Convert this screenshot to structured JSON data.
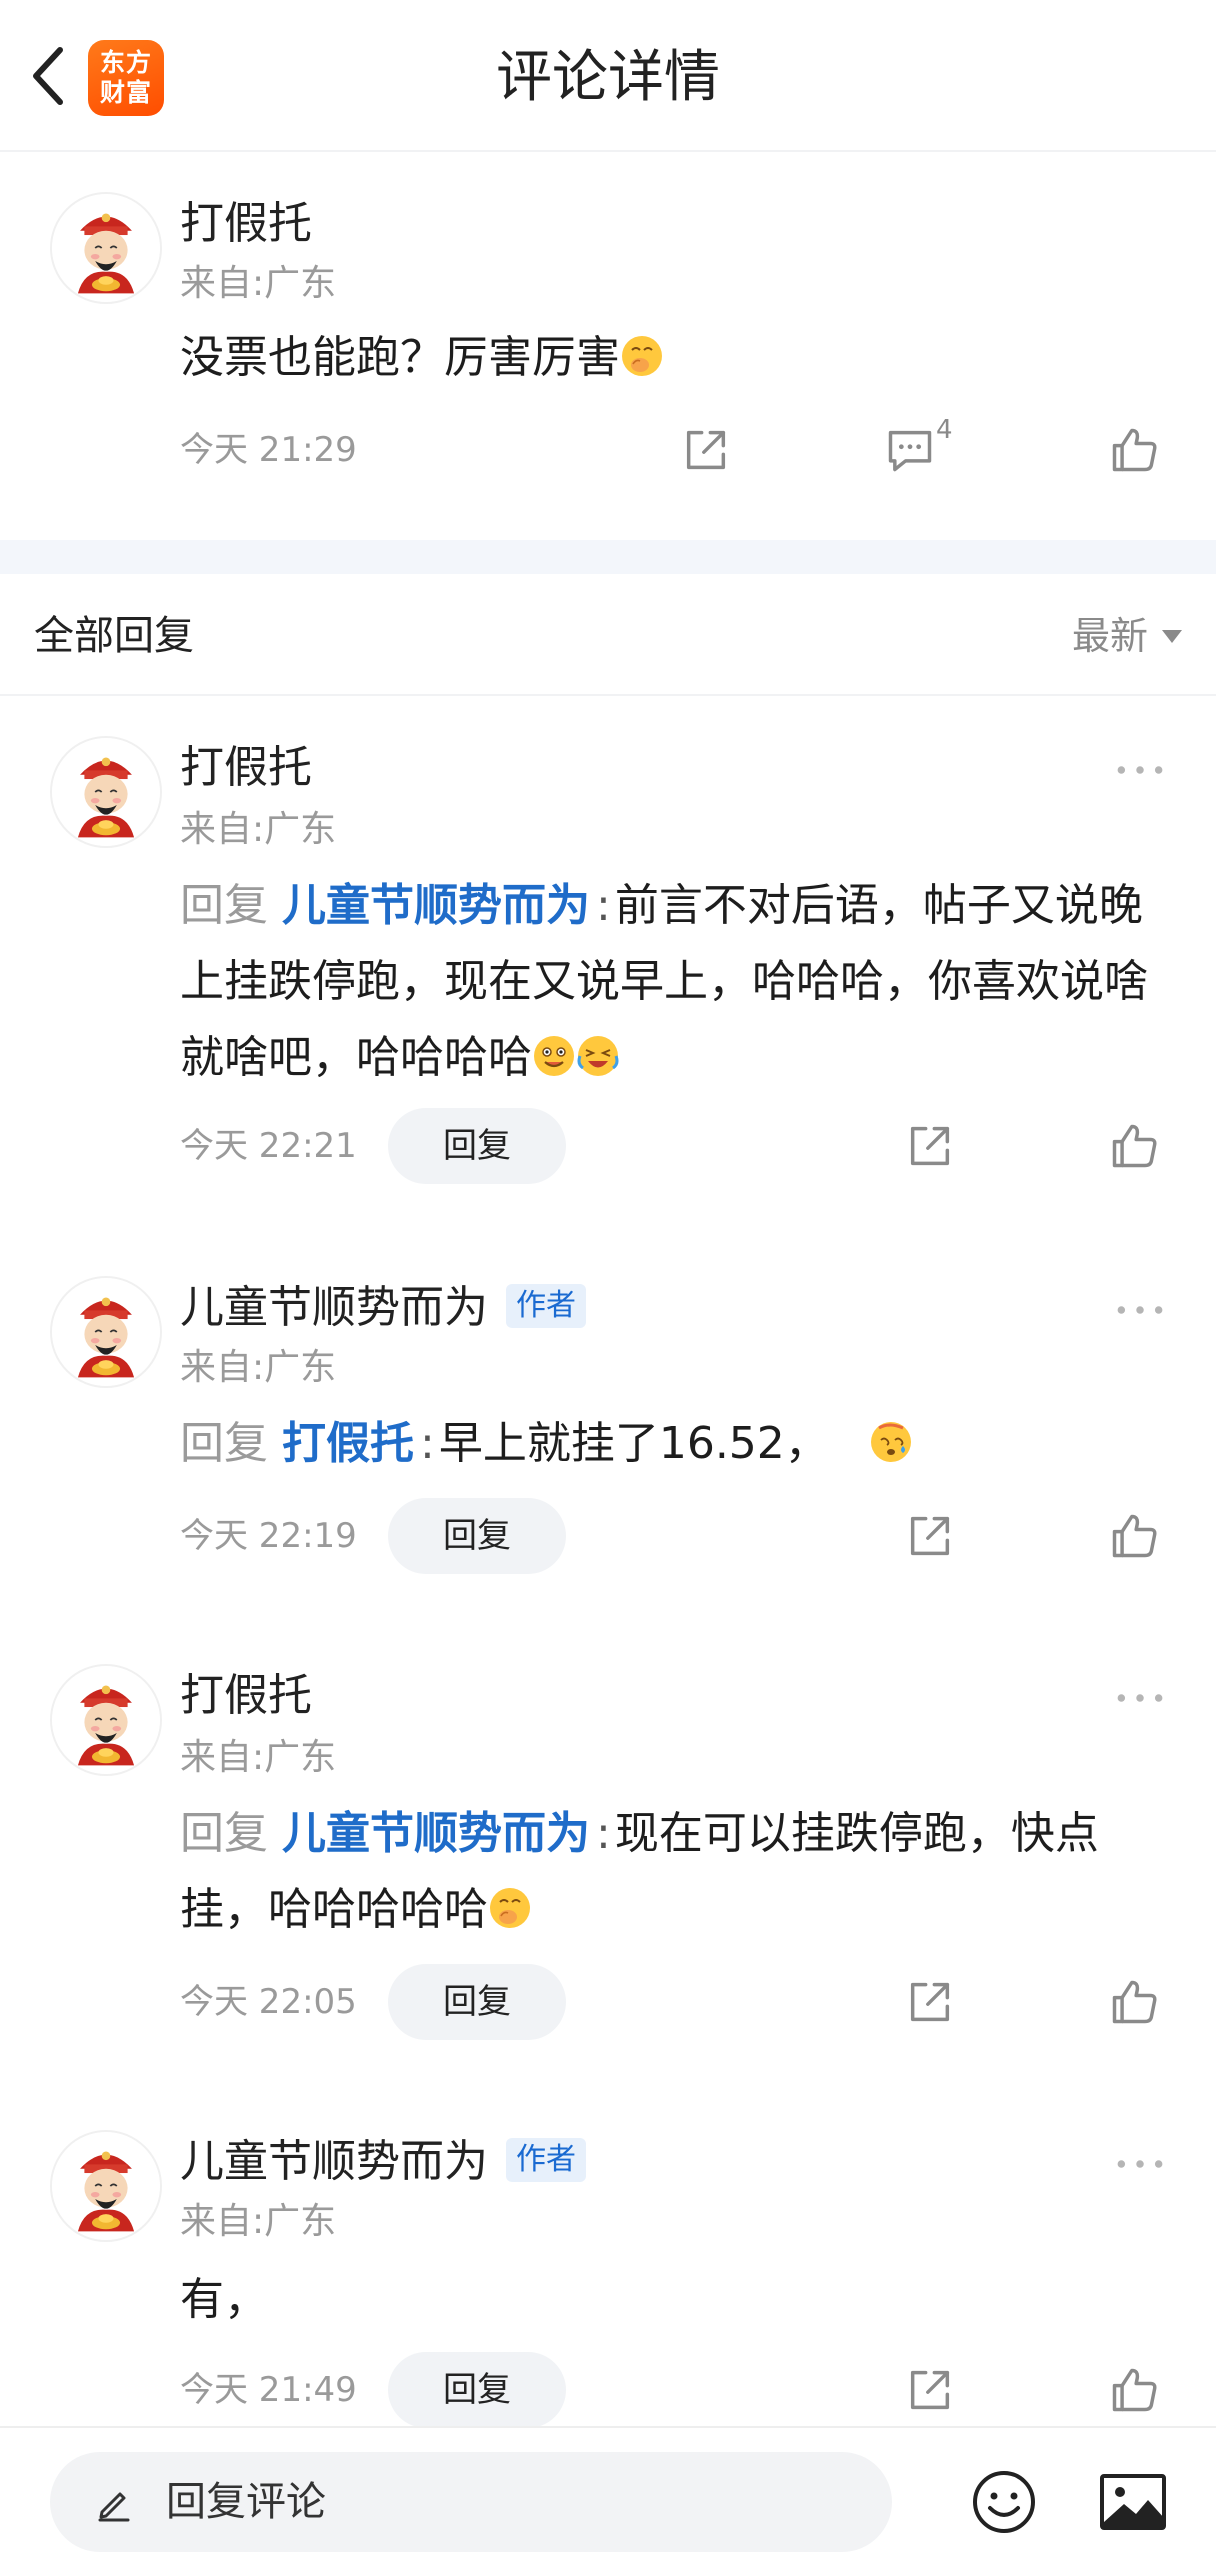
{
  "header": {
    "title": "评论详情",
    "logo_line1": "东方",
    "logo_line2": "财富"
  },
  "main_comment": {
    "username": "打假托",
    "location": "来自:广东",
    "text": "没票也能跑？厉害厉害",
    "time": "今天 21:29",
    "reply_count": "4"
  },
  "replies_section": {
    "title": "全部回复",
    "sort_label": "最新"
  },
  "replies": [
    {
      "username": "打假托",
      "is_author": false,
      "location": "来自:广东",
      "reply_prefix": "回复",
      "reply_to": "儿童节顺势而为",
      "colon": ":",
      "text": "前言不对后语，帖子又说晚上挂跌停跑，现在又说早上，哈哈哈，你喜欢说啥就啥吧，哈哈哈哈",
      "time": "今天 22:21",
      "reply_label": "回复"
    },
    {
      "username": "儿童节顺势而为",
      "is_author": true,
      "author_badge": "作者",
      "location": "来自:广东",
      "reply_prefix": "回复",
      "reply_to": "打假托",
      "colon": ":",
      "text": "早上就挂了16.52，",
      "time": "今天 22:19",
      "reply_label": "回复"
    },
    {
      "username": "打假托",
      "is_author": false,
      "location": "来自:广东",
      "reply_prefix": "回复",
      "reply_to": "儿童节顺势而为",
      "colon": ":",
      "text": "现在可以挂跌停跑，快点挂，哈哈哈哈哈",
      "time": "今天 22:05",
      "reply_label": "回复"
    },
    {
      "username": "儿童节顺势而为",
      "is_author": true,
      "author_badge": "作者",
      "location": "来自:广东",
      "text": "有，",
      "time": "今天 21:49",
      "reply_label": "回复"
    }
  ],
  "bottom_bar": {
    "input_placeholder": "回复评论"
  },
  "colors": {
    "link_blue": "#1f6cc9",
    "badge_bg": "#e7f0fb",
    "muted_gray": "#9a9a9a",
    "logo_orange": "#ff5a0a"
  },
  "icons": [
    "back-icon",
    "share-icon",
    "comment-icon",
    "like-icon",
    "more-icon",
    "pen-icon",
    "emoji-icon",
    "image-icon"
  ]
}
